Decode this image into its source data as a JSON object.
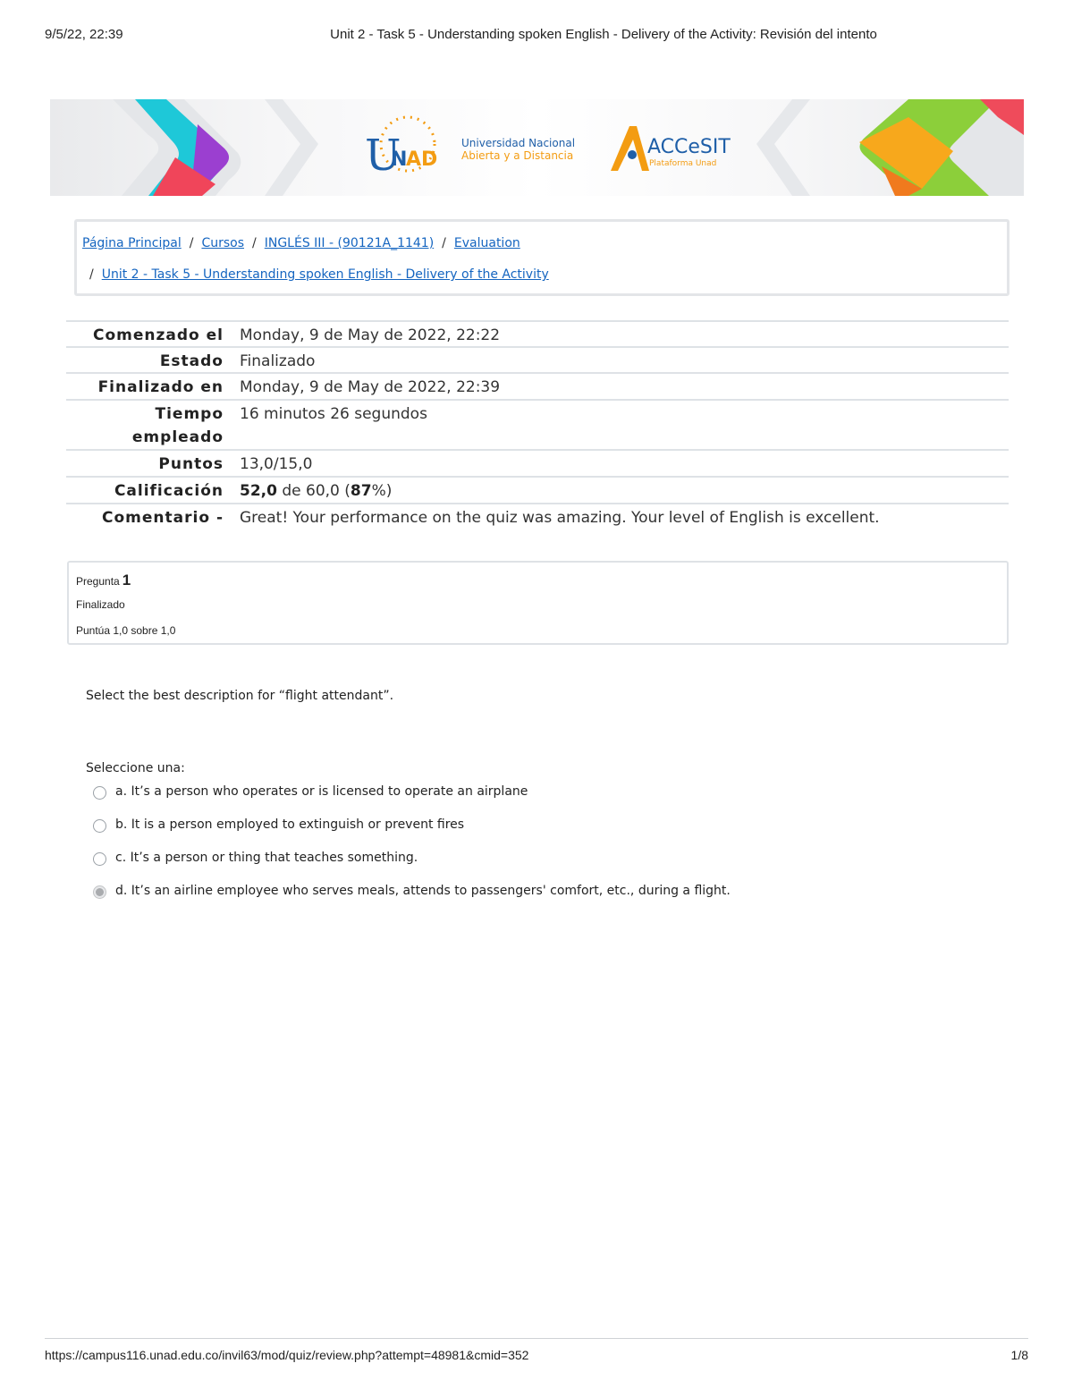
{
  "print_header": {
    "date": "9/5/22, 22:39",
    "title": "Unit 2 - Task 5 - Understanding spoken English - Delivery of the Activity: Revisión del intento"
  },
  "banner": {
    "unad_logo_text": "UNAD",
    "university_line1": "Universidad Nacional",
    "university_line2": "Abierta y a Distancia",
    "accesit_logo_text": "ACCeSIT",
    "accesit_subtitle": "Plataforma Unad"
  },
  "breadcrumb": {
    "items": [
      "Página Principal",
      "Cursos",
      "INGLÉS III - (90121A_1141)",
      "Evaluation",
      "Unit 2 - Task 5 - Understanding spoken English - Delivery of the Activity"
    ],
    "separator": "/"
  },
  "summary": {
    "started_label": "Comenzado el",
    "started_value": "Monday, 9 de May de 2022, 22:22",
    "state_label": "Estado",
    "state_value": "Finalizado",
    "finished_label": "Finalizado en",
    "finished_value": "Monday, 9 de May de 2022, 22:39",
    "time_label_1": "Tiempo",
    "time_label_2": "empleado",
    "time_value": "16 minutos 26 segundos",
    "points_label": "Puntos",
    "points_value": "13,0/15,0",
    "grade_label": "Calificación",
    "grade_score": "52,0",
    "grade_mid": " de 60,0 (",
    "grade_percent": "87",
    "grade_end": "%)",
    "comment_label": "Comentario -",
    "comment_value": "Great! Your performance on the quiz was amazing. Your level of English is excellent."
  },
  "question": {
    "label": "Pregunta",
    "number": "1",
    "state": "Finalizado",
    "grade": "Puntúa 1,0 sobre 1,0",
    "text": "Select the best description for “flight attendant”.",
    "prompt": "Seleccione una:",
    "answers": [
      "a. It’s a person who operates or is licensed to operate an airplane",
      "b. It is a person employed to extinguish or prevent fires",
      "c. It’s a person or thing that teaches something.",
      "d. It’s an airline employee who serves meals, attends to passengers' comfort, etc., during a flight."
    ],
    "selected_index": 3
  },
  "print_footer": {
    "url": "https://campus116.unad.edu.co/invil63/mod/quiz/review.php?attempt=48981&cmid=352",
    "page": "1/8"
  },
  "colors": {
    "link": "#1565c0",
    "unad_blue": "#1f5fa8",
    "unad_orange": "#f39c12",
    "border": "#dee2e6"
  }
}
